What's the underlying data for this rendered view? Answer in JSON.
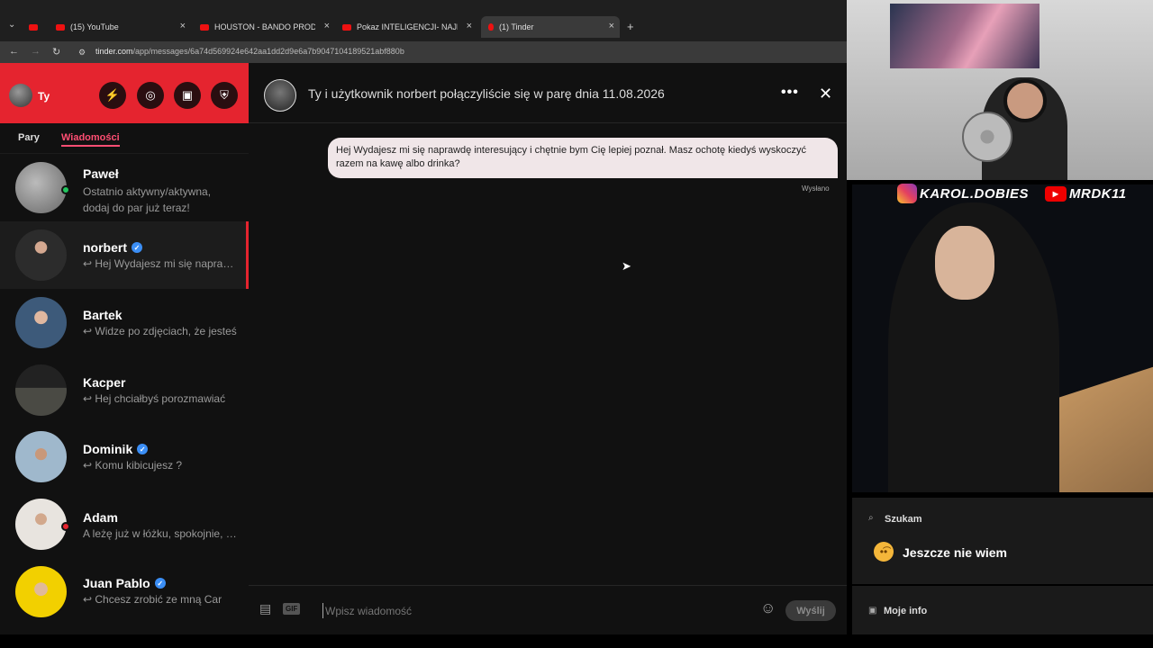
{
  "browser": {
    "tabs": [
      {
        "title": ""
      },
      {
        "title": "(15) YouTube"
      },
      {
        "title": "HOUSTON - BANDO PROD. PIE"
      },
      {
        "title": "Pokaz INTELIGENCJI- NAJLEPSZ"
      },
      {
        "title": "(1) Tinder"
      }
    ],
    "url_host": "tinder.com",
    "url_path": "/app/messages/6a74d569924e642aa1dd2d9e6a7b9047104189521abf880b"
  },
  "sidebar": {
    "profile_name": "Ty",
    "tabs": [
      "Pary",
      "Wiadomości"
    ],
    "conversations": [
      {
        "name": "Paweł",
        "preview": "Ostatnio aktywny/aktywna, dodaj do par już teraz!",
        "verified": false,
        "online": "#22c55e"
      },
      {
        "name": "norbert",
        "preview": "↩ Hej Wydajesz mi się naprawdę interesujący",
        "verified": true
      },
      {
        "name": "Bartek",
        "preview": "↩ Widze po zdjęciach, że jesteś",
        "verified": false
      },
      {
        "name": "Kacper",
        "preview": "↩ Hej chciałbyś porozmawiać",
        "verified": false
      },
      {
        "name": "Dominik",
        "preview": "↩ Komu kibicujesz ?",
        "verified": true
      },
      {
        "name": "Adam",
        "preview": "A leżę już w łóżku, spokojnie, dobranoc",
        "verified": false,
        "online": "#e5242f"
      },
      {
        "name": "Juan Pablo",
        "preview": "↩ Chcesz zrobić ze mną Car",
        "verified": true
      }
    ]
  },
  "chat": {
    "match_text": "Ty i użytkownik norbert połączyliście się w parę dnia 11.08.2026",
    "message": "Hej  Wydajesz mi się naprawdę interesujący i chętnie bym Cię lepiej poznał. Masz ochotę kiedyś wyskoczyć razem na kawę albo drinka?",
    "status": "Wysłano",
    "gif_label": "GIF",
    "input_placeholder": "Wpisz wiadomość",
    "send_label": "Wyślij"
  },
  "stream": {
    "instagram": "KAROL.DOBIES",
    "youtube": "MRDK11",
    "looking_label": "Szukam",
    "looking_value": "Jeszcze nie wiem",
    "my_info_label": "Moje info"
  },
  "colors": {
    "tinder_red": "#e5242f",
    "accent_pink": "#ff4e73",
    "verified_blue": "#3b8ef5"
  }
}
